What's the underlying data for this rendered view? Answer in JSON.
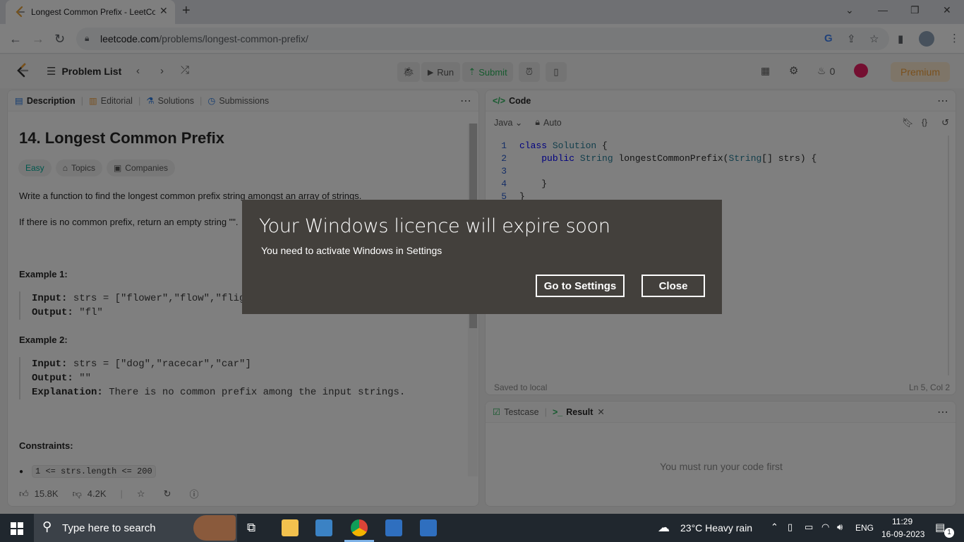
{
  "browser": {
    "tab_title": "Longest Common Prefix - LeetCode",
    "url_host": "leetcode.com",
    "url_path": "/problems/longest-common-prefix/"
  },
  "nav": {
    "problem_list": "Problem List",
    "run": "Run",
    "submit": "Submit",
    "streak": "0",
    "premium": "Premium"
  },
  "description": {
    "tabs": [
      "Description",
      "Editorial",
      "Solutions",
      "Submissions"
    ],
    "title": "14. Longest Common Prefix",
    "difficulty": "Easy",
    "topics": "Topics",
    "companies": "Companies",
    "para1": "Write a function to find the longest common prefix string amongst an array of strings.",
    "para2": "If there is no common prefix, return an empty string \"\".",
    "ex1_label": "Example 1:",
    "ex1_input_label": "Input:",
    "ex1_input": " strs = [\"flower\",\"flow\",\"flight\"]",
    "ex1_output_label": "Output:",
    "ex1_output": " \"fl\"",
    "ex2_label": "Example 2:",
    "ex2_input_label": "Input:",
    "ex2_input": " strs = [\"dog\",\"racecar\",\"car\"]",
    "ex2_output_label": "Output:",
    "ex2_output": " \"\"",
    "ex2_expl_label": "Explanation:",
    "ex2_expl": " There is no common prefix among the input strings.",
    "constraints_label": "Constraints:",
    "constraint1": "1 <= strs.length <= 200",
    "likes": "15.8K",
    "dislikes": "4.2K"
  },
  "code": {
    "tab": "Code",
    "language": "Java",
    "mode": "Auto",
    "lines": [
      "1",
      "2",
      "3",
      "4",
      "5"
    ],
    "status_left": "Saved to local",
    "status_right": "Ln 5, Col 2"
  },
  "result": {
    "testcase_tab": "Testcase",
    "result_tab": "Result",
    "empty_msg": "You must run your code first"
  },
  "dialog": {
    "title": "Your Windows licence will expire soon",
    "message": "You need to activate Windows in Settings",
    "settings_button": "Go to Settings",
    "close_button": "Close"
  },
  "taskbar": {
    "search_placeholder": "Type here to search",
    "weather": "23°C  Heavy rain",
    "lang": "ENG",
    "time": "11:29",
    "date": "16-09-2023",
    "notif_count": "1"
  }
}
